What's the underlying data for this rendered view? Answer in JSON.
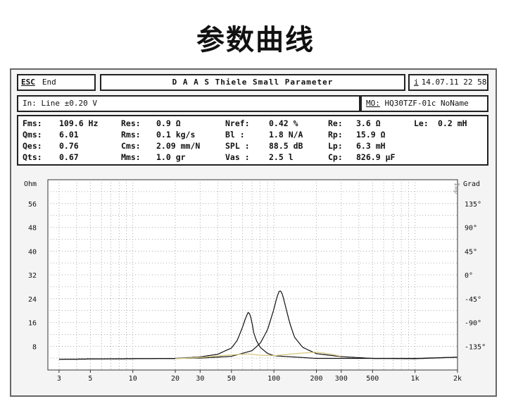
{
  "page": {
    "heading": "参数曲线"
  },
  "toolbar": {
    "esc_key": "ESC",
    "end_label": "End",
    "title": "D A A S  Thiele Small Parameter",
    "info_icon": "i",
    "datetime": "14.07.11  22 58"
  },
  "input_bar": {
    "input": "In: Line  ±0.20 V",
    "mo_label": "MO:",
    "mo_value": "HQ30TZF-01c NoName"
  },
  "params": {
    "rows": [
      [
        {
          "k": "Fms:",
          "v": "109.6 Hz"
        },
        {
          "k": "Res:",
          "v": "0.9 Ω"
        },
        {
          "k": "Nref:",
          "v": "0.42 %"
        },
        {
          "k": "Re:",
          "v": "3.6 Ω"
        },
        {
          "k": "Le:",
          "v": "0.2 mH"
        }
      ],
      [
        {
          "k": "Qms:",
          "v": "6.01"
        },
        {
          "k": "Rms:",
          "v": "0.1 kg/s"
        },
        {
          "k": "Bl  :",
          "v": "1.8 N/A"
        },
        {
          "k": "Rp:",
          "v": "15.9 Ω"
        }
      ],
      [
        {
          "k": "Qes:",
          "v": "0.76"
        },
        {
          "k": "Cms:",
          "v": "2.09 mm/N"
        },
        {
          "k": "SPL :",
          "v": "88.5 dB"
        },
        {
          "k": "Lp:",
          "v": "6.3 mH"
        }
      ],
      [
        {
          "k": "Qts:",
          "v": "0.67"
        },
        {
          "k": "Mms:",
          "v": "1.0 gr"
        },
        {
          "k": "Vas :",
          "v": "2.5 l"
        },
        {
          "k": "Cp:",
          "v": "826.9 μF"
        }
      ]
    ]
  },
  "chart_data": {
    "type": "line",
    "xscale": "log",
    "xlim": [
      2.5,
      2000
    ],
    "xticks": [
      3,
      5,
      10,
      20,
      30,
      50,
      100,
      200,
      300,
      500,
      1000,
      2000
    ],
    "xtick_labels": [
      "3",
      "5",
      "10",
      "20",
      "30",
      "50",
      "100",
      "200",
      "300",
      "500",
      "1k",
      "2k"
    ],
    "ylabel": "Ohm",
    "ylim": [
      0,
      64
    ],
    "yticks": [
      8,
      16,
      24,
      32,
      40,
      48,
      56
    ],
    "y2label": "Grad",
    "y2lim": [
      -180,
      180
    ],
    "y2ticks": [
      135,
      90,
      45,
      0,
      -45,
      -90,
      -135
    ],
    "y2tick_labels": [
      "135°",
      "90°",
      "45°",
      "0°",
      "-45°",
      "-90°",
      "-135°"
    ],
    "side_label": "Imp",
    "grid": true,
    "colors": {
      "curve": "#111111",
      "faint_curve": "#d9cc8a",
      "grid": "#999999",
      "background": "#ffffff"
    },
    "series": [
      {
        "x": [
          3,
          5,
          10,
          20,
          30,
          40,
          50,
          55,
          60,
          63,
          66,
          68,
          70,
          72,
          75,
          80,
          90,
          100,
          200,
          500,
          1000,
          2000
        ],
        "values": [
          3.6,
          3.7,
          3.8,
          3.9,
          4.4,
          5.3,
          7.4,
          10.0,
          14.5,
          17.5,
          19.6,
          18.5,
          15.8,
          12.5,
          10.0,
          7.6,
          5.6,
          4.8,
          3.9,
          3.9,
          3.9,
          4.3
        ]
      },
      {
        "x": [
          3,
          5,
          10,
          20,
          30,
          50,
          70,
          80,
          90,
          100,
          105,
          110,
          115,
          120,
          130,
          140,
          160,
          200,
          300,
          500,
          1000,
          2000
        ],
        "values": [
          3.6,
          3.7,
          3.8,
          3.9,
          4.0,
          4.6,
          6.5,
          9.0,
          13.5,
          20.5,
          24.5,
          27.0,
          25.5,
          22.0,
          15.5,
          11.0,
          7.6,
          5.5,
          4.5,
          3.9,
          3.8,
          4.3
        ]
      },
      {
        "x": [
          20,
          30,
          50,
          66,
          80,
          100,
          110,
          150,
          200,
          250,
          300
        ],
        "values": [
          3.8,
          4.2,
          5.1,
          5.4,
          5.0,
          4.8,
          5.0,
          5.6,
          6.0,
          5.4,
          4.6
        ]
      }
    ]
  }
}
